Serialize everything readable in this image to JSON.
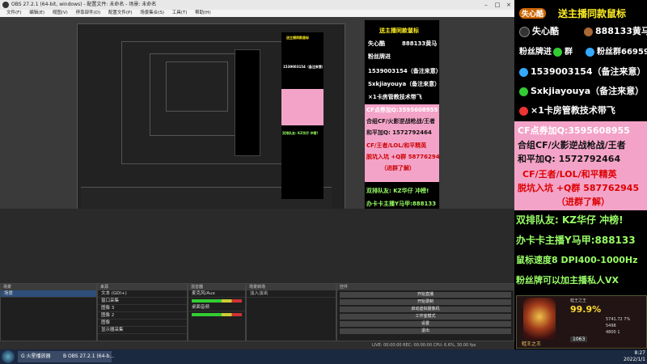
{
  "obs": {
    "title": "OBS 27.2.1 (64-bit, windows) - 配置文件: 未命名 - 场景: 未命名",
    "menu": [
      "文件(F)",
      "编辑(E)",
      "视图(V)",
      "停靠部件(D)",
      "配置文件(P)",
      "场景集合(S)",
      "工具(T)",
      "帮助(H)"
    ],
    "docks": {
      "scenes_title": "场景",
      "sources_title": "来源",
      "mixer_title": "混音器",
      "transitions_title": "场景转场",
      "controls_title": "控件",
      "scene_items": [
        "场景"
      ],
      "source_items": [
        "文本 (GDI+)",
        "窗口采集",
        "图像 3",
        "图像 2",
        "图像",
        "显示器采集"
      ],
      "mixer_items": [
        "麦克风/Aux",
        "桌面音频"
      ],
      "transition_selected": "淡入淡出",
      "controls": [
        "开始直播",
        "开始录制",
        "启动虚拟摄像机",
        "工作室模式",
        "设置",
        "退出"
      ]
    },
    "statusbar": "LIVE: 00:00:00   REC: 00:00:00   CPU: 6.6%, 30.00 fps"
  },
  "taskbar": {
    "items": [
      "G 火星播放器",
      "B OBS 27.2.1 (64-b..."
    ],
    "time": "8:27",
    "date": "2022/1/1"
  },
  "overlay": {
    "header": "送主播同款鼠标",
    "header_tag": "失心酷",
    "line_fans_contact": "失心酷",
    "line_fans_number": "888133黄马",
    "line_group": "粉丝牌进",
    "line_group_label": "群",
    "line_group_number": "粉丝群6695903",
    "qq": "1539003154（备注来意）",
    "wechat": "Sxkjiayouya（备注来意）",
    "card": "×1卡房管教技术带飞",
    "pink_lines": [
      "CF点券加Q:3595608955",
      "合组CF/火影逆战枪战/王者",
      "和平加Q:   1572792464",
      "CF/王者/LOL/和平精英",
      "脱坑入坑 +Q群 587762945",
      "（进群了解）"
    ],
    "green_lines": [
      "双排队友: KZ华仔 冲榜!",
      "办卡卡主播Y马甲:888133",
      "鼠标速度8 DPI400-1000Hz",
      "粉丝牌可以加主播私人VX"
    ],
    "game": {
      "name": "蛙王之王",
      "percent": "99.9%",
      "percent_label": "蛙王之王",
      "score": "1063",
      "stats": [
        "5741.72 7%",
        "5498",
        "4800 1"
      ]
    }
  },
  "colors": {
    "accent_yellow": "#ffee22",
    "pink": "#f4a3c8",
    "green_text": "#99ff66"
  }
}
